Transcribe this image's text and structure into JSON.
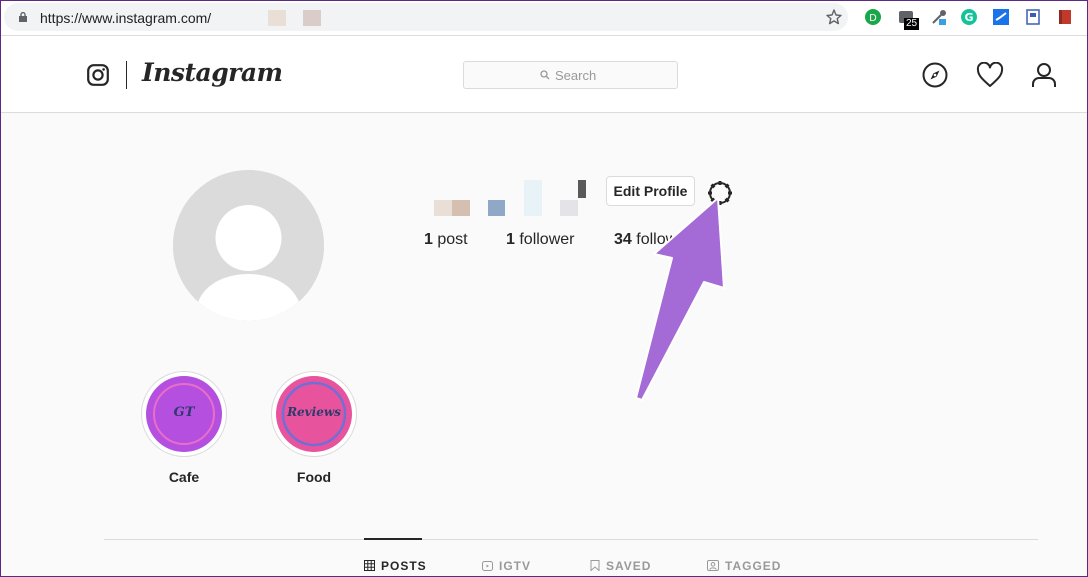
{
  "browser": {
    "url": "https://www.instagram.com/",
    "extension_badge": "25"
  },
  "header": {
    "wordmark": "Instagram",
    "search_placeholder": "Search"
  },
  "profile": {
    "edit_profile_label": "Edit Profile",
    "stats": {
      "posts_count": "1",
      "posts_label": " post",
      "followers_count": "1",
      "followers_label": " follower",
      "following_count": "34",
      "following_label": " following"
    }
  },
  "highlights": [
    {
      "label": "Cafe",
      "cover_text": "GT",
      "color": "#b44fe0"
    },
    {
      "label": "Food",
      "cover_text": "Reviews",
      "color": "#e8539e"
    }
  ],
  "tabs": [
    {
      "label": "POSTS",
      "active": true
    },
    {
      "label": "IGTV",
      "active": false
    },
    {
      "label": "SAVED",
      "active": false
    },
    {
      "label": "TAGGED",
      "active": false
    }
  ],
  "colors": {
    "annotation_arrow": "#a46bd6",
    "border": "#dbdbdb",
    "text": "#262626"
  }
}
